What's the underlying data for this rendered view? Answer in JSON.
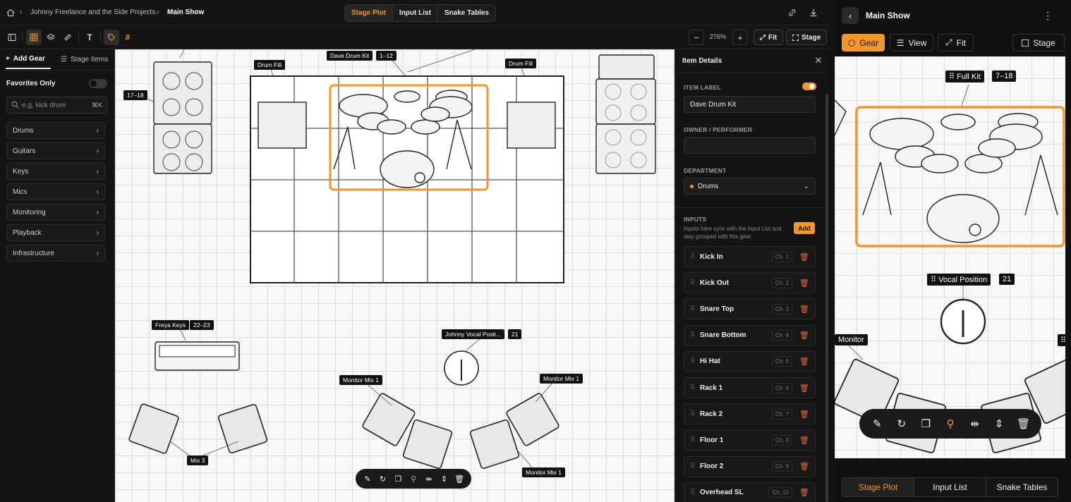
{
  "breadcrumb": {
    "home_icon": "home-icon",
    "project": "Johnny Freelance and the Side Projects",
    "page": "Main Show"
  },
  "views": {
    "tabs": [
      "Stage Plot",
      "Input List",
      "Snake Tables"
    ],
    "active": "Stage Plot"
  },
  "top_actions": {
    "link_icon": "link-icon",
    "download_icon": "download-icon"
  },
  "zoom": {
    "minus": "−",
    "value": "276%",
    "plus": "+",
    "fit": "Fit",
    "stage": "Stage"
  },
  "sidebar": {
    "tabs": {
      "add_gear": "Add Gear",
      "stage_items": "Stage Items"
    },
    "favorites_label": "Favorites Only",
    "search_placeholder": "e.g. kick drum",
    "search_shortcut": "⌘K",
    "categories": [
      "Drums",
      "Guitars",
      "Keys",
      "Mics",
      "Monitoring",
      "Playback",
      "Infrastructure"
    ]
  },
  "canvas_labels": {
    "drum_kit": "Dave Drum Kit",
    "drum_kit_ch": "1–12",
    "drum_fill_l": "Drum Fill",
    "drum_fill_r": "Drum Fill",
    "amp_l_ch": "17–18",
    "keys": "Freya Keys",
    "keys_ch": "22–23",
    "vocal": "Johnny Vocal Posit...",
    "vocal_ch": "21",
    "mon_a": "Monitor Mix 1",
    "mon_b": "Monitor Mix 1",
    "mon_c": "Monitor Mix 1",
    "mon_d": "Mix 3"
  },
  "details": {
    "title": "Item Details",
    "item_label_h": "ITEM LABEL",
    "item_label": "Dave Drum Kit",
    "owner_h": "OWNER / PERFORMER",
    "owner": "",
    "department_h": "DEPARTMENT",
    "department": "Drums",
    "department_color": "#f0962a",
    "inputs_h": "INPUTS",
    "inputs_desc": "Inputs here sync with the Input List and stay grouped with this gear.",
    "add": "Add",
    "inputs": [
      {
        "name": "Kick In",
        "ch": "Ch. 1"
      },
      {
        "name": "Kick Out",
        "ch": "Ch. 2"
      },
      {
        "name": "Snare Top",
        "ch": "Ch. 3"
      },
      {
        "name": "Snare Bottom",
        "ch": "Ch. 4"
      },
      {
        "name": "Hi Hat",
        "ch": "Ch. 5"
      },
      {
        "name": "Rack 1",
        "ch": "Ch. 6"
      },
      {
        "name": "Rack 2",
        "ch": "Ch. 7"
      },
      {
        "name": "Floor 1",
        "ch": "Ch. 8"
      },
      {
        "name": "Floor 2",
        "ch": "Ch. 9"
      },
      {
        "name": "Overhead SL",
        "ch": "Ch. 10"
      }
    ]
  },
  "mobile": {
    "title": "Main Show",
    "gear": "Gear",
    "view": "View",
    "fit": "Fit",
    "stage": "Stage",
    "full_kit": "Full Kit",
    "full_kit_ch": "7–18",
    "vocal": "Vocal Position",
    "vocal_ch": "21",
    "monitor": "Monitor",
    "tabs": [
      "Stage Plot",
      "Input List",
      "Snake Tables"
    ]
  },
  "colors": {
    "accent": "#f0962a",
    "bg": "#121212",
    "canvas": "#f8f8f8"
  }
}
